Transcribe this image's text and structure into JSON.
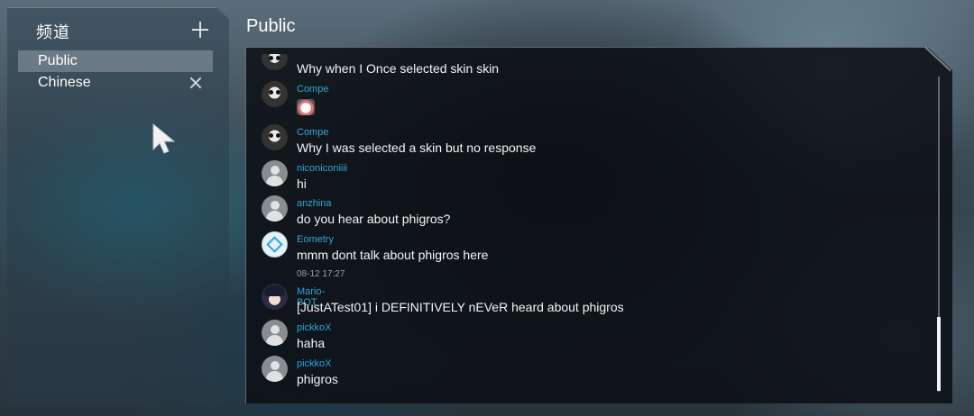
{
  "sidebar": {
    "header": "频道",
    "channels": [
      {
        "label": "Public",
        "active": true
      },
      {
        "label": "Chinese",
        "closable": true
      }
    ]
  },
  "chat": {
    "title": "Public",
    "messages": [
      {
        "user": "",
        "text": "Why when I  Once selected skin skin",
        "avatar": "skull-avatar"
      },
      {
        "user": "Compe",
        "text": "",
        "sticker": "girl-sticker-icon",
        "avatar": "skull-avatar"
      },
      {
        "user": "Compe",
        "text": "Why I was  selected  a skin but  no response",
        "avatar": "skull-avatar"
      },
      {
        "user": "niconiconiiii",
        "text": "hi",
        "avatar": "default-user-avatar"
      },
      {
        "user": "anzhina",
        "text": "do you hear about phigros?",
        "avatar": "default-user-avatar"
      },
      {
        "user": "Eometry",
        "text": "mmm dont talk about phigros here",
        "avatar": "geometry-logo-avatar"
      },
      {
        "timestamp": "08-12 17:27"
      },
      {
        "user": "Mario-BOT",
        "text": "[JustATest01] i DEFINITIVELY nEVeR heard about phigros",
        "avatar": "anime-avatar"
      },
      {
        "user": "pickkoX",
        "text": "haha",
        "avatar": "default-user-avatar"
      },
      {
        "user": "pickkoX",
        "text": "phigros",
        "avatar": "default-user-avatar"
      }
    ]
  },
  "colors": {
    "username": "#2fa6da",
    "text": "#f4f4f4",
    "panel": "#0c1014"
  }
}
